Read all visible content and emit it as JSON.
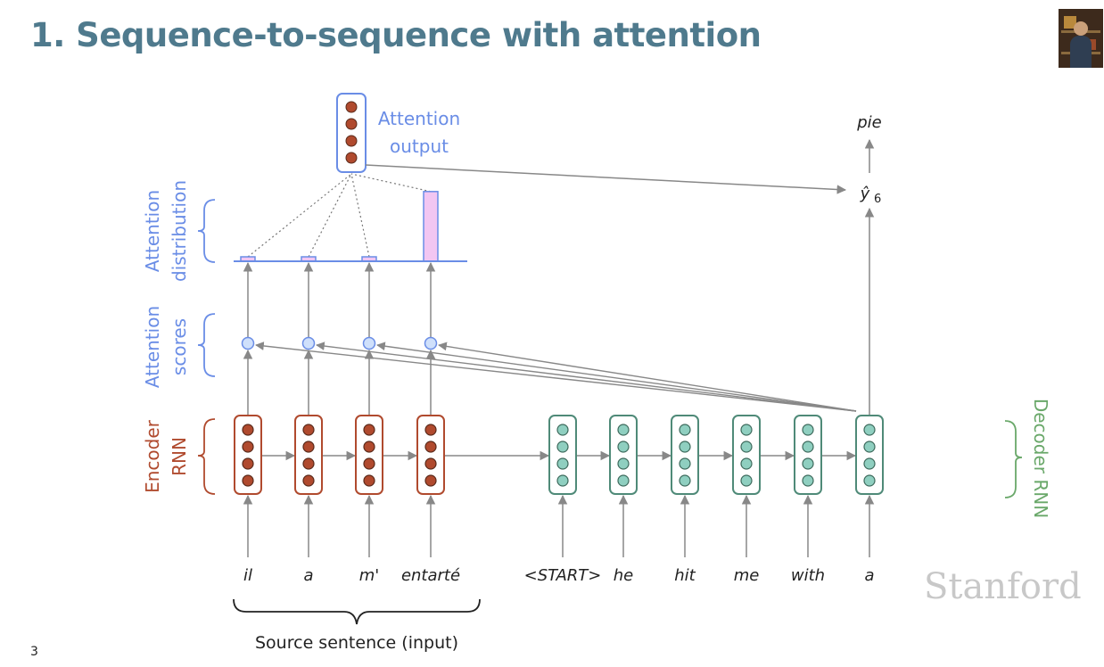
{
  "slide": {
    "title": "1. Sequence-to-sequence with attention",
    "page_number": "3",
    "logo_text": "Stanford"
  },
  "diagram": {
    "labels": {
      "attention_output_line1": "Attention",
      "attention_output_line2": "output",
      "attention_distribution_line1": "Attention",
      "attention_distribution_line2": "distribution",
      "attention_scores_line1": "Attention",
      "attention_scores_line2": "scores",
      "encoder_rnn_line1": "Encoder",
      "encoder_rnn_line2": "RNN",
      "decoder_rnn": "Decoder RNN",
      "source_sentence": "Source sentence (input)"
    },
    "source_words": [
      "il",
      "a",
      "m'",
      "entarté"
    ],
    "decoder_inputs": [
      "<START>",
      "he",
      "hit",
      "me",
      "with",
      "a"
    ],
    "output_word": "pie",
    "output_symbol": "ŷ",
    "output_subscript": "6",
    "attention_weights": [
      0.05,
      0.05,
      0.05,
      0.85
    ],
    "colors": {
      "title": "#4f7a8d",
      "attention": "#6a8de6",
      "encoder": "#b04a2e",
      "decoder": "#4f8a78",
      "attention_bar": "#f2c6f2",
      "arrow": "#888888"
    }
  }
}
